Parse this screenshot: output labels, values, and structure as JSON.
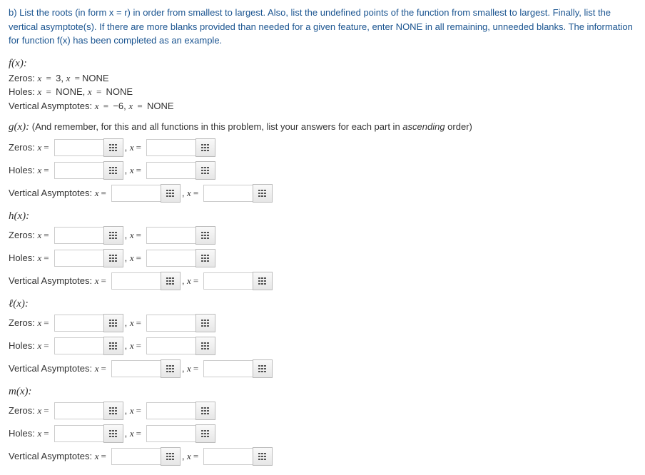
{
  "intro": "b) List the roots (in form x = r) in order from smallest to largest. Also, list the undefined points of the function from smallest to largest. Finally, list the vertical asymptote(s). If there are more blanks provided than needed for a given feature, enter NONE in all remaining, unneeded blanks. The information for function f(x) has been completed as an example.",
  "example": {
    "header": "f(x):",
    "zeros_label": "Zeros:",
    "zeros_1_pre": "x = ",
    "zeros_1_val": "3",
    "zeros_sep": ", ",
    "zeros_2_pre": "x =",
    "zeros_2_val": "NONE",
    "holes_label": "Holes:",
    "holes_1_pre": "x = ",
    "holes_1_val": "NONE",
    "holes_sep": ", ",
    "holes_2_pre": "x = ",
    "holes_2_val": "NONE",
    "va_label": "Vertical Asymptotes:",
    "va_1_pre": "x = ",
    "va_1_val": "−6",
    "va_sep": ", ",
    "va_2_pre": "x = ",
    "va_2_val": "NONE"
  },
  "g": {
    "header": "g(x):",
    "instr_pre": " (And remember, for this and all functions in this problem, list your answers for each part in ",
    "instr_em": "ascending",
    "instr_post": " order)"
  },
  "h": {
    "header": "h(x):"
  },
  "l": {
    "header": "ℓ(x):"
  },
  "m": {
    "header": "m(x):"
  },
  "labels": {
    "zeros": "Zeros:",
    "holes": "Holes:",
    "va": "Vertical Asymptotes:",
    "x": "x",
    "eq": "=",
    "comma": ", "
  }
}
